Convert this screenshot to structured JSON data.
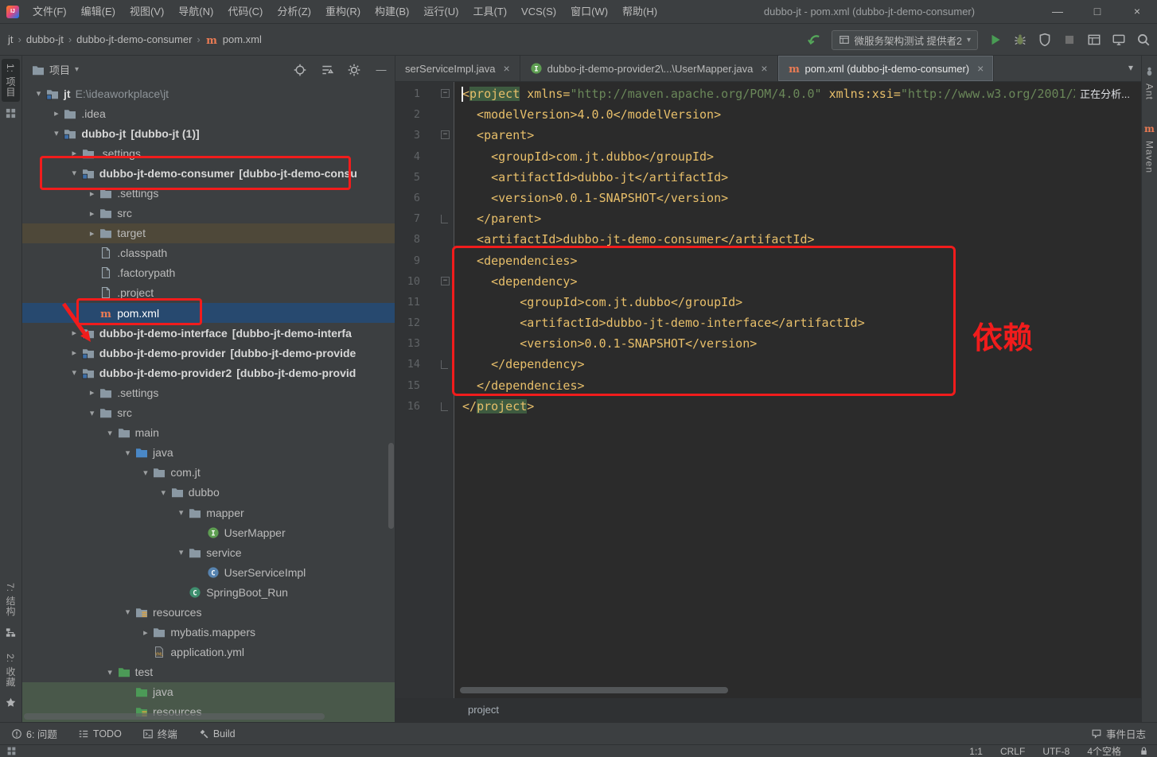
{
  "colors": {
    "annotation_red": "#F11C1C",
    "selection_blue": "#27496F",
    "code_gold": "#E8BF6A",
    "code_green": "#6A8759",
    "chrome_bg": "#3C3F41",
    "editor_bg": "#2B2B2B"
  },
  "title_bar": {
    "menus": [
      "文件(F)",
      "编辑(E)",
      "视图(V)",
      "导航(N)",
      "代码(C)",
      "分析(Z)",
      "重构(R)",
      "构建(B)",
      "运行(U)",
      "工具(T)",
      "VCS(S)",
      "窗口(W)",
      "帮助(H)"
    ],
    "title": "dubbo-jt - pom.xml (dubbo-jt-demo-consumer)",
    "controls": {
      "minimize": "—",
      "maximize": "□",
      "close": "×"
    }
  },
  "nav_bar": {
    "breadcrumbs": [
      "jt",
      "dubbo-jt",
      "dubbo-jt-demo-consumer",
      "pom.xml"
    ],
    "breadcrumb_file_icon": "maven",
    "run_config": "微服务架构测试 提供者2",
    "toolbar_icon_names": [
      "maven-reimport-icon",
      "run-icon",
      "debug-icon",
      "coverage-icon",
      "stop-icon",
      "layout-icon",
      "monitor-icon",
      "search-icon"
    ]
  },
  "left_stripe": {
    "top": [
      {
        "label": "1: 项目",
        "icon": "project-tool-icon"
      }
    ],
    "bottom": [
      {
        "label": "7: 结构",
        "icon": "structure-tool-icon"
      },
      {
        "label": "2: 收藏",
        "icon": "favorites-star-icon"
      }
    ]
  },
  "right_stripe": {
    "items": [
      {
        "label": "Ant",
        "icon": "ant-tool-icon"
      },
      {
        "label": "Maven",
        "icon": "maven-tool-icon"
      }
    ]
  },
  "project_panel": {
    "header": {
      "title": "项目",
      "icon_names": [
        "locate-icon",
        "collapse-all-icon",
        "gear-icon",
        "hide-icon"
      ]
    },
    "tree": [
      {
        "lvl": 0,
        "chev": "open",
        "icon": "folder-root",
        "label": "jt",
        "extra": "E:\\ideaworkplace\\jt",
        "bold": true,
        "extra_dim": true
      },
      {
        "lvl": 1,
        "chev": "closed",
        "icon": "folder",
        "label": ".idea"
      },
      {
        "lvl": 1,
        "chev": "open",
        "icon": "module",
        "label": "dubbo-jt",
        "extra": "[dubbo-jt (1)]",
        "bold": true
      },
      {
        "lvl": 2,
        "chev": "closed",
        "icon": "folder",
        "label": ".settings"
      },
      {
        "lvl": 2,
        "chev": "open",
        "icon": "module",
        "label": "dubbo-jt-demo-consumer",
        "extra": "[dubbo-jt-demo-consu",
        "bold": true
      },
      {
        "lvl": 3,
        "chev": "closed",
        "icon": "folder",
        "label": ".settings"
      },
      {
        "lvl": 3,
        "chev": "closed",
        "icon": "folder",
        "label": "src"
      },
      {
        "lvl": 3,
        "chev": "closed",
        "icon": "folder",
        "label": "target",
        "bg": "excluded"
      },
      {
        "lvl": 3,
        "icon": "file",
        "label": ".classpath"
      },
      {
        "lvl": 3,
        "icon": "file",
        "label": ".factorypath"
      },
      {
        "lvl": 3,
        "icon": "file",
        "label": ".project"
      },
      {
        "lvl": 3,
        "icon": "maven",
        "label": "pom.xml",
        "sel": true
      },
      {
        "lvl": 2,
        "chev": "closed",
        "icon": "module",
        "label": "dubbo-jt-demo-interface",
        "extra": "[dubbo-jt-demo-interfa",
        "bold": true
      },
      {
        "lvl": 2,
        "chev": "closed",
        "icon": "module",
        "label": "dubbo-jt-demo-provider",
        "extra": "[dubbo-jt-demo-provide",
        "bold": true
      },
      {
        "lvl": 2,
        "chev": "open",
        "icon": "module",
        "label": "dubbo-jt-demo-provider2",
        "extra": "[dubbo-jt-demo-provid",
        "bold": true
      },
      {
        "lvl": 3,
        "chev": "closed",
        "icon": "folder",
        "label": ".settings"
      },
      {
        "lvl": 3,
        "chev": "open",
        "icon": "folder",
        "label": "src"
      },
      {
        "lvl": 4,
        "chev": "open",
        "icon": "folder",
        "label": "main"
      },
      {
        "lvl": 5,
        "chev": "open",
        "icon": "folder-src",
        "label": "java"
      },
      {
        "lvl": 6,
        "chev": "open",
        "icon": "package",
        "label": "com.jt"
      },
      {
        "lvl": 7,
        "chev": "open",
        "icon": "package",
        "label": "dubbo"
      },
      {
        "lvl": 8,
        "chev": "open",
        "icon": "package",
        "label": "mapper"
      },
      {
        "lvl": 9,
        "icon": "interface",
        "label": "UserMapper"
      },
      {
        "lvl": 8,
        "chev": "open",
        "icon": "package",
        "label": "service"
      },
      {
        "lvl": 9,
        "icon": "class",
        "label": "UserServiceImpl"
      },
      {
        "lvl": 8,
        "icon": "class-run",
        "label": "SpringBoot_Run"
      },
      {
        "lvl": 5,
        "chev": "open",
        "icon": "folder-res",
        "label": "resources"
      },
      {
        "lvl": 6,
        "chev": "closed",
        "icon": "folder",
        "label": "mybatis.mappers"
      },
      {
        "lvl": 6,
        "icon": "yml",
        "label": "application.yml"
      },
      {
        "lvl": 4,
        "chev": "open",
        "icon": "folder-test",
        "label": "test"
      },
      {
        "lvl": 5,
        "icon": "folder-test",
        "label": "java",
        "bg": "test"
      },
      {
        "lvl": 5,
        "icon": "folder-res-test",
        "label": "resources",
        "bg": "test"
      }
    ]
  },
  "editor": {
    "tabs": [
      {
        "label": "serServiceImpl.java",
        "icon": null,
        "active": false
      },
      {
        "label": "dubbo-jt-demo-provider2\\...\\UserMapper.java",
        "icon": "interface",
        "active": false
      },
      {
        "label": "pom.xml (dubbo-jt-demo-consumer)",
        "icon": "maven",
        "active": true
      }
    ],
    "analyzing": "正在分析...",
    "breadcrumb": "project",
    "code": {
      "caret_line": 1,
      "fold_start": [
        1,
        3,
        10
      ],
      "fold_end": [
        7,
        14,
        16
      ],
      "lines": [
        {
          "seg": [
            [
              "t",
              "<"
            ],
            [
              "hl",
              "project"
            ],
            [
              "t",
              " xmlns="
            ],
            [
              "s",
              "\"http://maven.apache.org/POM/4.0.0\""
            ],
            [
              "t",
              " xmlns:xsi="
            ],
            [
              "s",
              "\"http://www.w3.org/2001/X"
            ]
          ]
        },
        {
          "seg": [
            [
              "t",
              "  <modelVersion>4.0.0</modelVersion>"
            ]
          ]
        },
        {
          "seg": [
            [
              "t",
              "  <parent>"
            ]
          ]
        },
        {
          "seg": [
            [
              "t",
              "    <groupId>com.jt.dubbo</groupId>"
            ]
          ]
        },
        {
          "seg": [
            [
              "t",
              "    <artifactId>dubbo-jt</artifactId>"
            ]
          ]
        },
        {
          "seg": [
            [
              "t",
              "    <version>0.0.1-SNAPSHOT</version>"
            ]
          ]
        },
        {
          "seg": [
            [
              "t",
              "  </parent>"
            ]
          ]
        },
        {
          "seg": [
            [
              "t",
              "  <artifactId>dubbo-jt-demo-consumer</artifactId>"
            ]
          ]
        },
        {
          "seg": [
            [
              "t",
              "  <dependencies>"
            ]
          ]
        },
        {
          "seg": [
            [
              "t",
              "    <dependency>"
            ]
          ]
        },
        {
          "seg": [
            [
              "t",
              "        <groupId>com.jt.dubbo</groupId>"
            ]
          ]
        },
        {
          "seg": [
            [
              "t",
              "        <artifactId>dubbo-jt-demo-interface</artifactId>"
            ]
          ]
        },
        {
          "seg": [
            [
              "t",
              "        <version>0.0.1-SNAPSHOT</version>"
            ]
          ]
        },
        {
          "seg": [
            [
              "t",
              "    </dependency>"
            ]
          ]
        },
        {
          "seg": [
            [
              "t",
              "  </dependencies>"
            ]
          ]
        },
        {
          "seg": [
            [
              "t",
              "</"
            ],
            [
              "hl",
              "project"
            ],
            [
              "t",
              ">"
            ]
          ]
        }
      ]
    }
  },
  "annotations": {
    "dependency_label": "依赖"
  },
  "bottom_bar": {
    "left": [
      {
        "label": "6: 问题",
        "icon": "problems-icon"
      },
      {
        "label": "TODO",
        "icon": "todo-icon"
      },
      {
        "label": "终端",
        "icon": "terminal-icon"
      },
      {
        "label": "Build",
        "icon": "build-hammer-icon"
      }
    ],
    "right": {
      "label": "事件日志",
      "icon": "event-log-icon"
    }
  },
  "status_bar": {
    "items": [
      "1:1",
      "CRLF",
      "UTF-8",
      "4个空格"
    ],
    "lock_icon": "lock-icon"
  }
}
